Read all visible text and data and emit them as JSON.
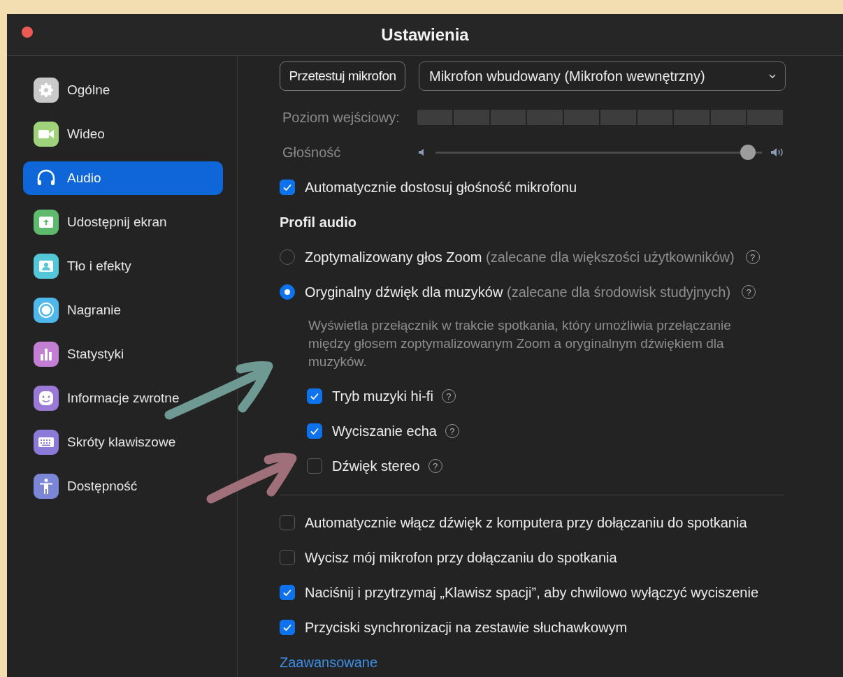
{
  "window": {
    "title": "Ustawienia"
  },
  "sidebar": {
    "items": [
      {
        "label": "Ogólne",
        "color": "#c9c9c9",
        "selected": false
      },
      {
        "label": "Wideo",
        "color": "#9fd27a",
        "selected": false
      },
      {
        "label": "Audio",
        "selected": true
      },
      {
        "label": "Udostępnij ekran",
        "color": "#5fba6e",
        "selected": false
      },
      {
        "label": "Tło i efekty",
        "color": "#53c6d8",
        "selected": false
      },
      {
        "label": "Nagranie",
        "color": "#4fb7ea",
        "selected": false
      },
      {
        "label": "Statystyki",
        "color": "#c27fd4",
        "selected": false
      },
      {
        "label": "Informacje zwrotne",
        "color": "#9a7ad6",
        "selected": false
      },
      {
        "label": "Skróty klawiszowe",
        "color": "#8c7ad8",
        "selected": false
      },
      {
        "label": "Dostępność",
        "color": "#7b86d6",
        "selected": false
      }
    ]
  },
  "audio": {
    "microphone": {
      "test_button": "Przetestuj mikrofon",
      "device": "Mikrofon wbudowany (Mikrofon wewnętrzny)",
      "input_level_label": "Poziom wejściowy:",
      "input_level": {
        "level": 0
      },
      "volume_label": "Głośność",
      "volume": {
        "level": 0.98
      }
    },
    "auto_adjust": {
      "label": "Automatycznie dostosuj głośność mikrofonu",
      "checked": true
    },
    "profile": {
      "heading": "Profil audio",
      "options": [
        {
          "label": "Zoptymalizowany głos Zoom",
          "note": "(zalecane dla większości użytkowników)",
          "help": "?",
          "selected": false
        },
        {
          "label": "Oryginalny dźwięk dla muzyków",
          "note": "(zalecane dla środowisk studyjnych)",
          "help": "?",
          "selected": true
        }
      ],
      "description": "Wyświetla przełącznik w trakcie spotkania, który umożliwia przełączanie między głosem zoptymalizowanym Zoom a oryginalnym dźwiękiem dla muzyków.",
      "sub_options": [
        {
          "label": "Tryb muzyki hi-fi",
          "help": "?",
          "checked": true
        },
        {
          "label": "Wyciszanie echa",
          "help": "?",
          "checked": true
        },
        {
          "label": "Dźwięk stereo",
          "help": "?",
          "checked": false
        }
      ]
    },
    "options": [
      {
        "label": "Automatycznie włącz dźwięk z komputera przy dołączaniu do spotkania",
        "checked": false
      },
      {
        "label": "Wycisz mój mikrofon przy dołączaniu do spotkania",
        "checked": false
      },
      {
        "label": "Naciśnij i przytrzymaj „Klawisz spacji”, aby chwilowo wyłączyć wyciszenie",
        "checked": true
      },
      {
        "label": "Przyciski synchronizacji na zestawie słuchawkowym",
        "checked": true
      }
    ],
    "advanced_link": "Zaawansowane"
  },
  "annotations": [
    {
      "kind": "arrow",
      "color": "#6f9a94"
    },
    {
      "kind": "arrow",
      "color": "#a0707a"
    }
  ]
}
